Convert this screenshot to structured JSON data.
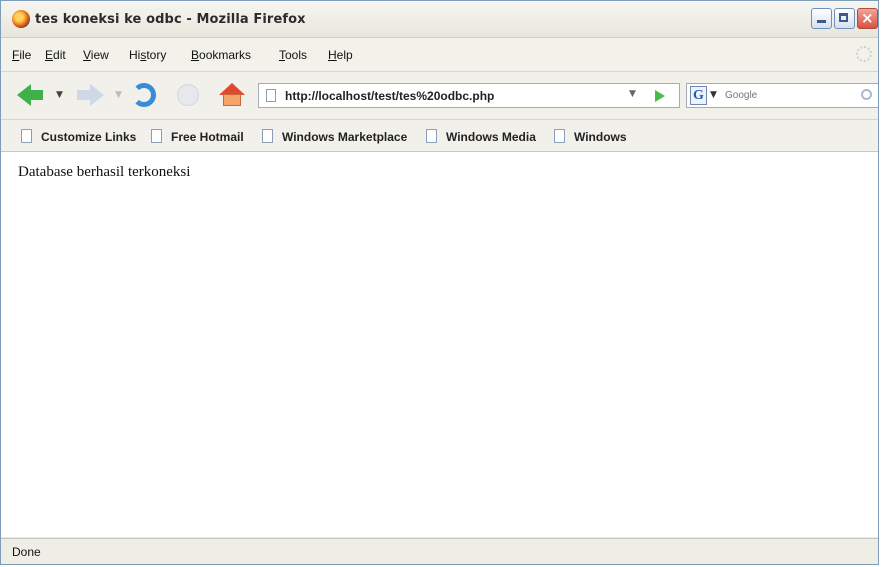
{
  "window": {
    "title": "tes koneksi ke odbc - Mozilla Firefox",
    "close_glyph": "×"
  },
  "menu": {
    "items": [
      {
        "accel": "F",
        "rest": "ile"
      },
      {
        "accel": "E",
        "rest": "dit"
      },
      {
        "accel": "V",
        "rest": "iew"
      },
      {
        "pre": "Hi",
        "accel": "s",
        "rest": "tory"
      },
      {
        "accel": "B",
        "rest": "ookmarks"
      },
      {
        "accel": "T",
        "rest": "ools"
      },
      {
        "accel": "H",
        "rest": "elp"
      }
    ]
  },
  "navigation": {
    "drop_glyph": "▼",
    "url": "http://localhost/test/tes%20odbc.php",
    "search_engine": "G",
    "search_placeholder": "Google"
  },
  "bookmarks": [
    {
      "label": "Customize Links"
    },
    {
      "label": "Free Hotmail"
    },
    {
      "label": "Windows Marketplace"
    },
    {
      "label": "Windows Media"
    },
    {
      "label": "Windows"
    }
  ],
  "page": {
    "message": "Database berhasil terkoneksi"
  },
  "status": {
    "text": "Done"
  },
  "colors": {
    "accent_green": "#3fb04a",
    "reload_blue": "#3a8bd8",
    "home_red": "#e0492d"
  }
}
